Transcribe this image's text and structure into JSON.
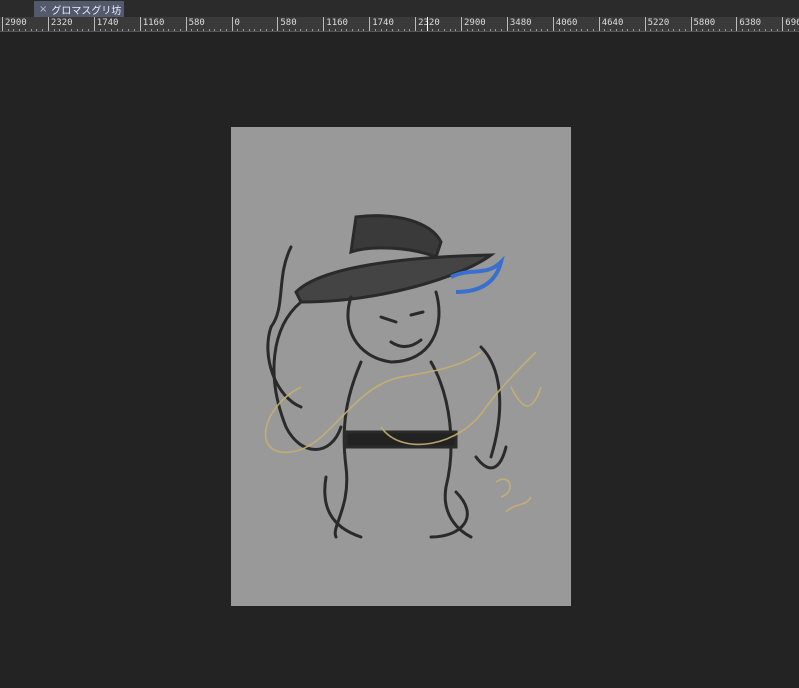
{
  "document_tab": {
    "title": "グロマスグリ坊",
    "close_icon": "×"
  },
  "ruler": {
    "labels": [
      "2900",
      "2320",
      "1740",
      "1160",
      "580",
      "0",
      "580",
      "1160",
      "1740",
      "2320",
      "2900",
      "3480",
      "4060",
      "4640",
      "5220",
      "5800",
      "6380",
      "696"
    ]
  },
  "canvas": {
    "background": "#999999",
    "artwork": "character-sketch-with-signature"
  }
}
